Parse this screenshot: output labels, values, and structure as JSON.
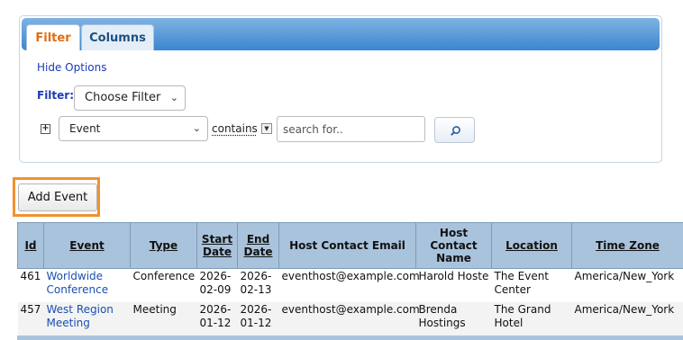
{
  "tabs": {
    "filter": "Filter",
    "columns": "Columns"
  },
  "hide_options": "Hide Options",
  "filter_label": "Filter:",
  "choose_filter": "Choose Filter",
  "criteria": {
    "field": "Event",
    "operator": "contains",
    "search_placeholder": "search for..",
    "add_icon": "plus-icon",
    "search_icon": "magnifier-icon"
  },
  "add_event_label": "Add Event",
  "colors": {
    "accent": "#f0922f",
    "header_bg": "#a9c3dc",
    "link": "#1b4fb0",
    "tab_active": "#e06c10"
  },
  "table": {
    "headers": [
      "Id",
      "Event",
      "Type",
      "Start Date",
      "End Date",
      "Host Contact Email",
      "Host Contact Name",
      "Location",
      "Time Zone"
    ],
    "rows": [
      [
        "461",
        "Worldwide Conference",
        "Conference",
        "2026-02-09",
        "2026-02-13",
        "eventhost@example.com",
        "Harold Hoste",
        "The Event Center",
        "America/New_York"
      ],
      [
        "457",
        "West Region Meeting",
        "Meeting",
        "2026-01-12",
        "2026-01-12",
        "eventhost@example.com",
        "Brenda Hostings",
        "The Grand Hotel",
        "America/New_York"
      ]
    ]
  }
}
